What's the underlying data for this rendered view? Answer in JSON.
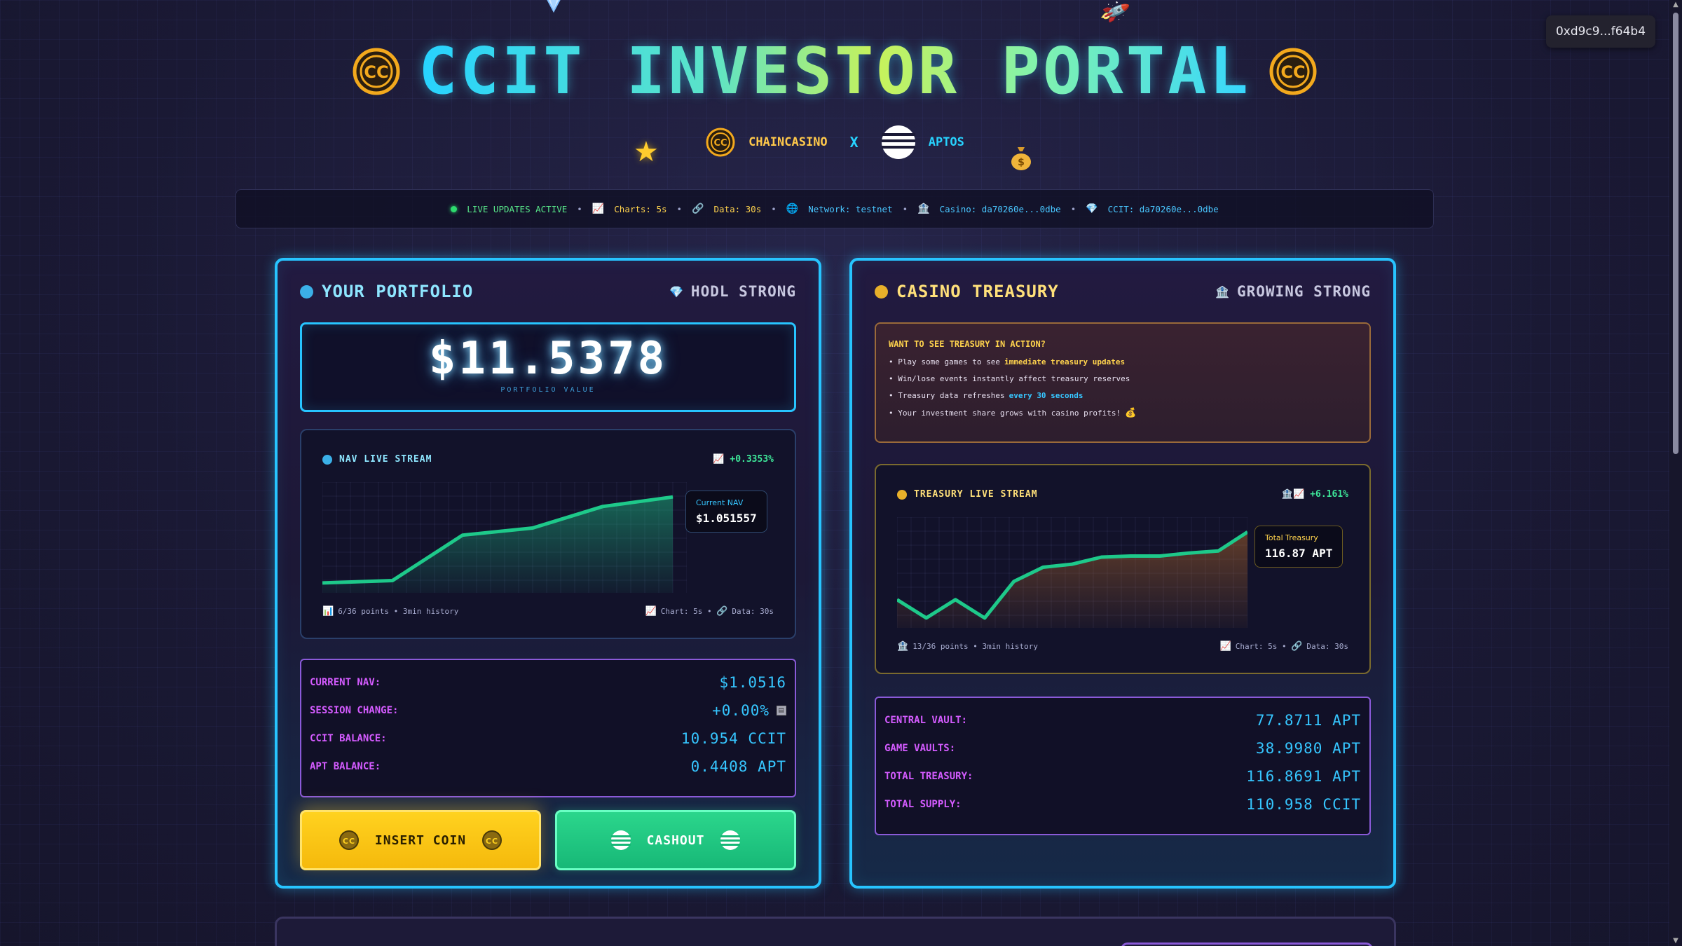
{
  "wallet": {
    "address": "0xd9c9...f64b4"
  },
  "header": {
    "title": "CCIT INVESTOR PORTAL",
    "partner_left": "CHAINCASINO",
    "partner_sep": "X",
    "partner_right": "APTOS"
  },
  "status_bar": {
    "live": "LIVE UPDATES ACTIVE",
    "charts": "Charts: 5s",
    "data": "Data: 30s",
    "network": "Network: testnet",
    "casino": "Casino: da70260e...0dbe",
    "ccit": "CCIT: da70260e...0dbe"
  },
  "portfolio": {
    "title": "YOUR PORTFOLIO",
    "tag": "HODL STRONG",
    "value": "$11.5378",
    "value_label": "PORTFOLIO VALUE",
    "chart": {
      "title": "NAV LIVE STREAM",
      "change": "+0.3353%",
      "tooltip_label": "Current NAV",
      "tooltip_value": "$1.051557",
      "footer_left": "6/36 points • 3min history",
      "footer_right_chart": "Chart: 5s",
      "footer_right_data": "Data: 30s"
    },
    "stats": [
      {
        "label": "CURRENT NAV:",
        "value": "$1.0516"
      },
      {
        "label": "SESSION CHANGE:",
        "value": "+0.00%"
      },
      {
        "label": "CCIT BALANCE:",
        "value": "10.954 CCIT"
      },
      {
        "label": "APT BALANCE:",
        "value": "0.4408 APT"
      }
    ],
    "insert_label": "INSERT COIN",
    "cashout_label": "CASHOUT"
  },
  "treasury": {
    "title": "CASINO TREASURY",
    "tag": "GROWING STRONG",
    "info": {
      "title": "WANT TO SEE TREASURY IN ACTION?",
      "line1_pre": "• Play some games to see",
      "line1_hl": "immediate treasury updates",
      "line2": "• Win/lose events instantly affect treasury reserves",
      "line3_pre": "• Treasury data refreshes",
      "line3_hl": "every 30 seconds",
      "line4": "• Your investment share grows with casino profits!"
    },
    "chart": {
      "title": "TREASURY LIVE STREAM",
      "change": "+6.161%",
      "tooltip_label": "Total Treasury",
      "tooltip_value": "116.87 APT",
      "footer_left": "13/36 points • 3min history",
      "footer_right_chart": "Chart: 5s",
      "footer_right_data": "Data: 30s"
    },
    "stats": [
      {
        "label": "CENTRAL VAULT:",
        "value": "77.8711 APT"
      },
      {
        "label": "GAME VAULTS:",
        "value": "38.9980 APT"
      },
      {
        "label": "TOTAL TREASURY:",
        "value": "116.8691 APT"
      },
      {
        "label": "TOTAL SUPPLY:",
        "value": "110.958 CCIT"
      }
    ]
  },
  "chart_data": [
    {
      "type": "line",
      "title": "NAV LIVE STREAM",
      "x": [
        1,
        2,
        3,
        4,
        5,
        6
      ],
      "values": [
        1.048,
        1.0481,
        1.05,
        1.0503,
        1.0512,
        1.0516
      ]
    },
    {
      "type": "line",
      "title": "TREASURY LIVE STREAM",
      "x": [
        1,
        2,
        3,
        4,
        5,
        6,
        7,
        8,
        9,
        10,
        11,
        12,
        13
      ],
      "values": [
        110.2,
        108.4,
        110.2,
        108.4,
        112.0,
        113.4,
        113.7,
        114.4,
        114.5,
        114.5,
        114.8,
        115.0,
        116.87
      ]
    }
  ],
  "colors": {
    "accent_cyan": "#27c4ff",
    "accent_yellow": "#ffd21f",
    "accent_green": "#2bd68c",
    "label_magenta": "#d45bff"
  }
}
